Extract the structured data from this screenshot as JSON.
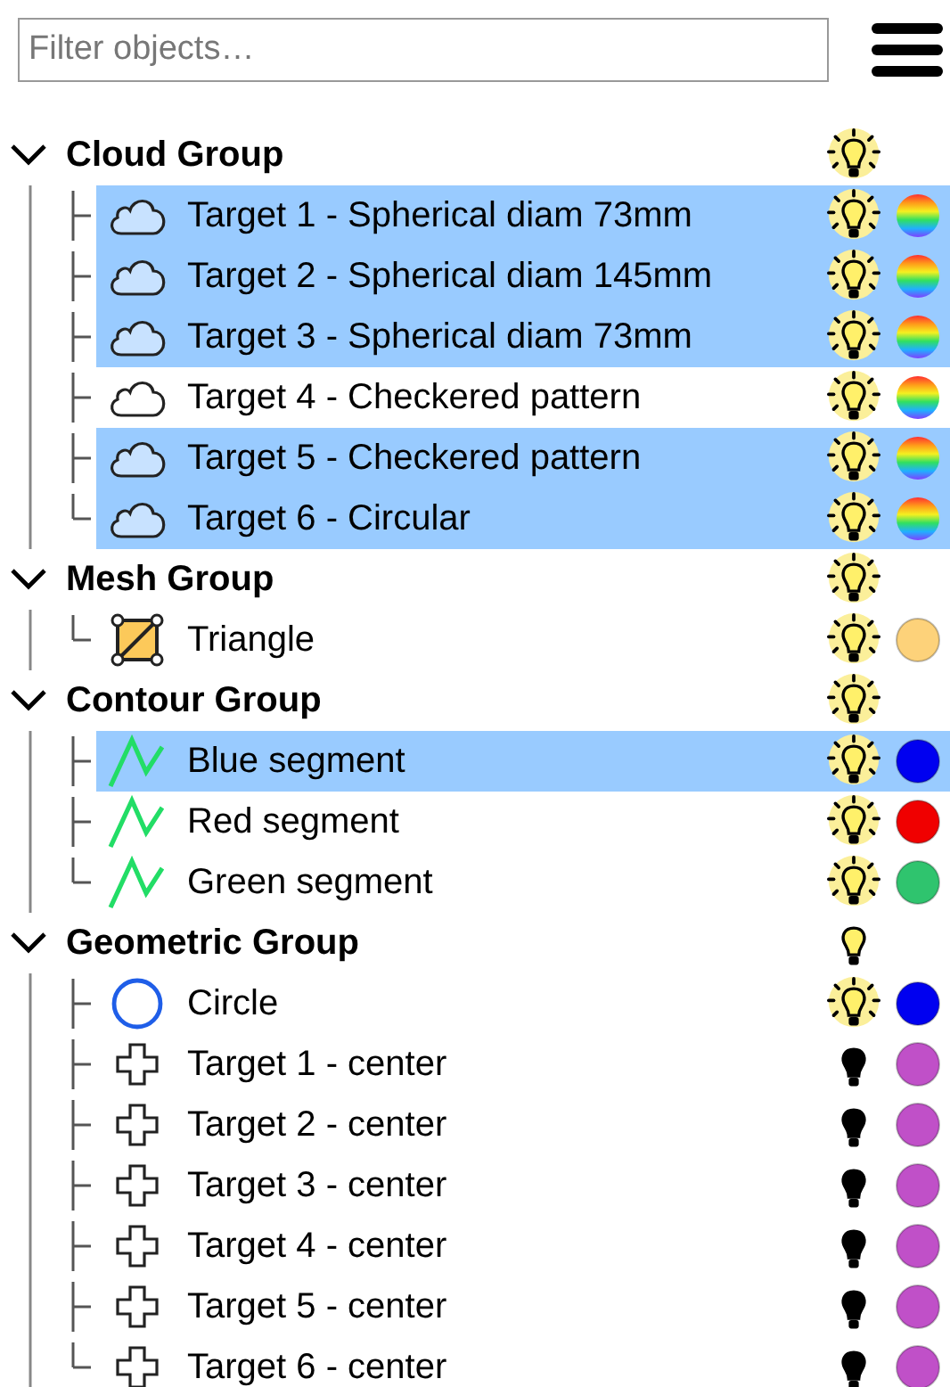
{
  "filter": {
    "placeholder": "Filter objects…"
  },
  "groups": [
    {
      "label": "Cloud Group",
      "expanded": true,
      "visible": true,
      "glow": true,
      "children": [
        {
          "label": "Target 1 - Spherical diam 73mm",
          "kind": "cloud",
          "selected": true,
          "visible": true,
          "glow": true,
          "scalar_colors": true
        },
        {
          "label": "Target 2 - Spherical diam 145mm",
          "kind": "cloud",
          "selected": true,
          "visible": true,
          "glow": true,
          "scalar_colors": true
        },
        {
          "label": "Target 3 - Spherical diam 73mm",
          "kind": "cloud",
          "selected": true,
          "visible": true,
          "glow": true,
          "scalar_colors": true
        },
        {
          "label": "Target 4 - Checkered pattern",
          "kind": "cloud",
          "selected": false,
          "visible": true,
          "glow": true,
          "scalar_colors": true
        },
        {
          "label": "Target 5 - Checkered pattern",
          "kind": "cloud",
          "selected": true,
          "visible": true,
          "glow": true,
          "scalar_colors": true
        },
        {
          "label": "Target 6 - Circular",
          "kind": "cloud",
          "selected": true,
          "visible": true,
          "glow": true,
          "scalar_colors": true
        }
      ]
    },
    {
      "label": "Mesh Group",
      "expanded": true,
      "visible": true,
      "glow": true,
      "children": [
        {
          "label": "Triangle",
          "kind": "mesh",
          "selected": false,
          "visible": true,
          "glow": true,
          "scalar_colors": false,
          "color": "#fdd27a"
        }
      ]
    },
    {
      "label": "Contour Group",
      "expanded": true,
      "visible": true,
      "glow": true,
      "children": [
        {
          "label": "Blue segment",
          "kind": "polyline",
          "selected": true,
          "visible": true,
          "glow": true,
          "scalar_colors": false,
          "color": "#0000f0"
        },
        {
          "label": "Red segment",
          "kind": "polyline",
          "selected": false,
          "visible": true,
          "glow": true,
          "scalar_colors": false,
          "color": "#f00000"
        },
        {
          "label": "Green segment",
          "kind": "polyline",
          "selected": false,
          "visible": true,
          "glow": true,
          "scalar_colors": false,
          "color": "#2fc46e"
        }
      ]
    },
    {
      "label": "Geometric Group",
      "expanded": true,
      "visible": true,
      "glow": false,
      "children": [
        {
          "label": "Circle",
          "kind": "circle",
          "selected": false,
          "visible": true,
          "glow": true,
          "scalar_colors": false,
          "color": "#0000f0"
        },
        {
          "label": "Target 1 - center",
          "kind": "cross",
          "selected": false,
          "visible": false,
          "glow": false,
          "scalar_colors": false,
          "color": "#c050c8"
        },
        {
          "label": "Target 2 - center",
          "kind": "cross",
          "selected": false,
          "visible": false,
          "glow": false,
          "scalar_colors": false,
          "color": "#c050c8"
        },
        {
          "label": "Target 3 - center",
          "kind": "cross",
          "selected": false,
          "visible": false,
          "glow": false,
          "scalar_colors": false,
          "color": "#c050c8"
        },
        {
          "label": "Target 4 - center",
          "kind": "cross",
          "selected": false,
          "visible": false,
          "glow": false,
          "scalar_colors": false,
          "color": "#c050c8"
        },
        {
          "label": "Target 5 - center",
          "kind": "cross",
          "selected": false,
          "visible": false,
          "glow": false,
          "scalar_colors": false,
          "color": "#c050c8"
        },
        {
          "label": "Target 6 - center",
          "kind": "cross",
          "selected": false,
          "visible": false,
          "glow": false,
          "scalar_colors": false,
          "color": "#c050c8"
        }
      ]
    }
  ]
}
